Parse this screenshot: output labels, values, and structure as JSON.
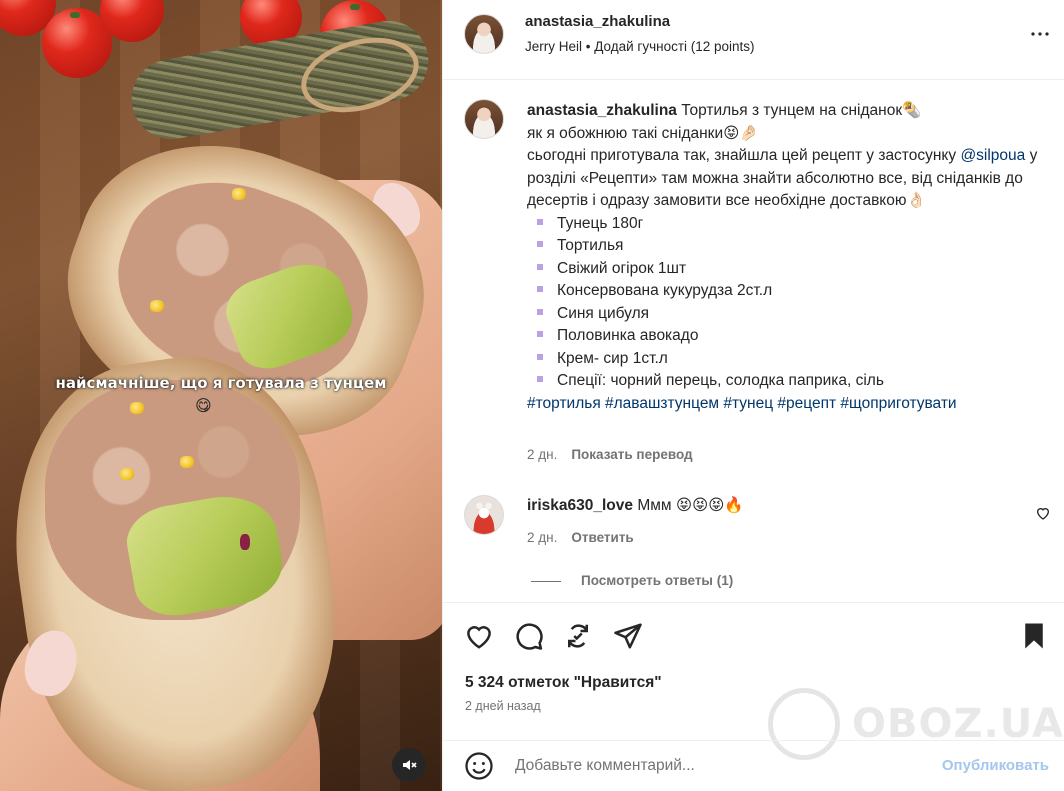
{
  "media": {
    "overlay_text": "найсмачніше, що я готувала з тунцем",
    "overlay_emoji": "😋",
    "mute_icon": "speaker-muted-icon"
  },
  "header": {
    "username": "anastasia_zhakulina",
    "audio": "Jerry Heil • Додай гучності (12 points)",
    "more_icon": "more-horizontal-icon"
  },
  "caption": {
    "username": "anastasia_zhakulina",
    "line1": " Тортилья з тунцем на сніданок🌯",
    "line2": "як я обожнюю такі сніданки😝🤌🏻",
    "line3": "сьогодні приготувала так, знайшла цей рецепт у застосунку ",
    "mention": "@silpoua",
    "line4": " у розділі «Рецепти» там можна знайти абсолютно все, від сніданків до десертів і одразу замовити все необхідне доставкою👌🏻",
    "ingredients": [
      "Тунець 180г",
      "Тортилья",
      "Свіжий огірок 1шт",
      "Консервована кукурудза 2ст.л",
      "Синя цибуля",
      "Половинка авокадо",
      "Крем- сир 1ст.л",
      "Спеції: чорний перець, солодка паприка, сіль"
    ],
    "hashtags": "#тортилья #лавашзтунцем #тунец #рецепт #щоприготувати",
    "time": "2 дн.",
    "translate": "Показать перевод"
  },
  "comment": {
    "username": "iriska630_love",
    "text": " Ммм 😝😝😝🔥",
    "time": "2 дн.",
    "reply": "Ответить",
    "view_replies": "Посмотреть ответы (1)"
  },
  "actions": {
    "like_icon": "heart-icon",
    "comment_icon": "comment-icon",
    "repost_icon": "repost-icon",
    "share_icon": "send-icon",
    "save_icon": "bookmark-filled-icon"
  },
  "likes": "5 324 отметок \"Нравится\"",
  "posted_ago": "2 дней назад",
  "watermark": "OBOZ.UA",
  "comment_bar": {
    "placeholder": "Добавьте комментарий...",
    "post_label": "Опубликовать"
  }
}
